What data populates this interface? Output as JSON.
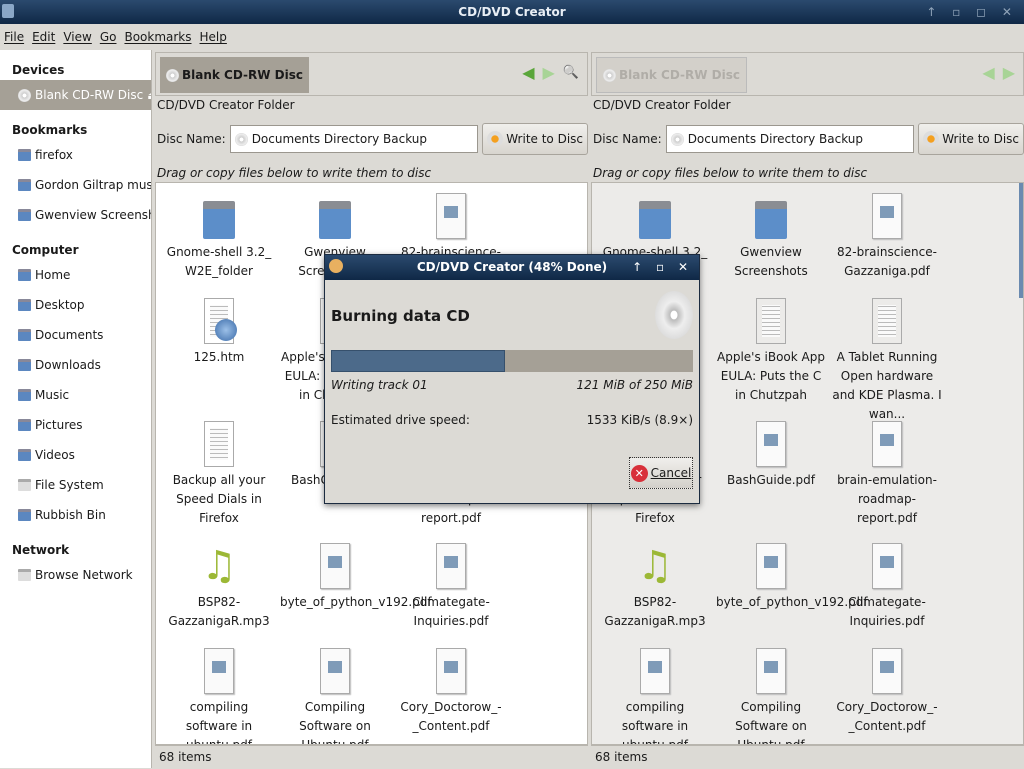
{
  "window": {
    "title": "CD/DVD Creator",
    "controls": "↑ ▫ ◻ ✕"
  },
  "menu": [
    "File",
    "Edit",
    "View",
    "Go",
    "Bookmarks",
    "Help"
  ],
  "sidebar": {
    "devices_header": "Devices",
    "devices": [
      {
        "label": "Blank CD-RW Disc",
        "icon": "disc-icon",
        "selected": true
      }
    ],
    "bookmarks_header": "Bookmarks",
    "bookmarks": [
      "firefox",
      "Gordon Giltrap music...",
      "Gwenview Screenshots"
    ],
    "computer_header": "Computer",
    "computer": [
      "Home",
      "Desktop",
      "Documents",
      "Downloads",
      "Music",
      "Pictures",
      "Videos",
      "File System",
      "Rubbish Bin"
    ],
    "network_header": "Network",
    "network": [
      "Browse Network"
    ]
  },
  "pane": {
    "location": "Blank CD-RW Disc",
    "folder_label": "CD/DVD Creator Folder",
    "disc_name_label": "Disc Name:",
    "disc_name_value": "Documents Directory Backup",
    "write_button": "Write to Disc",
    "hint": "Drag or copy files below to write them to disc",
    "status": "68 items",
    "files": [
      {
        "name": "Gnome-shell 3.2_ W2E_folder",
        "type": "folder"
      },
      {
        "name": "Gwenview Screenshots",
        "type": "folder"
      },
      {
        "name": "82-brainscience-Gazzaniga.pdf",
        "type": "doc"
      },
      {
        "name": "125.htm",
        "type": "html"
      },
      {
        "name": "Apple's iBook App EULA: Puts the C in Chutzpah",
        "type": "text"
      },
      {
        "name": "A Tablet Running Open hardware and KDE Plasma. I wan...",
        "type": "text"
      },
      {
        "name": "Backup all your Speed Dials in Firefox",
        "type": "text"
      },
      {
        "name": "BashGuide.pdf",
        "type": "doc"
      },
      {
        "name": "brain-emulation-roadmap-report.pdf",
        "type": "doc"
      },
      {
        "name": "BSP82-GazzanigaR.mp3",
        "type": "music"
      },
      {
        "name": "byte_of_python_v192.pdf",
        "type": "doc"
      },
      {
        "name": "Climategate-Inquiries.pdf",
        "type": "doc"
      },
      {
        "name": "compiling software in ubuntu.pdf",
        "type": "doc"
      },
      {
        "name": "Compiling Software on Ubuntu.pdf",
        "type": "doc"
      },
      {
        "name": "Cory_Doctorow_-_Content.pdf",
        "type": "doc"
      }
    ]
  },
  "dialog": {
    "title": "CD/DVD Creator (48% Done)",
    "heading": "Burning data CD",
    "progress_percent": 48,
    "track": "Writing track 01",
    "amount": "121 MiB of 250 MiB",
    "speed_label": "Estimated drive speed:",
    "speed_value": "1533 KiB/s (8.9×)",
    "cancel": "Cancel"
  },
  "colors": {
    "titlebar": "#0f2846",
    "selection": "#a5a096",
    "progress": "#4c6a8a"
  }
}
